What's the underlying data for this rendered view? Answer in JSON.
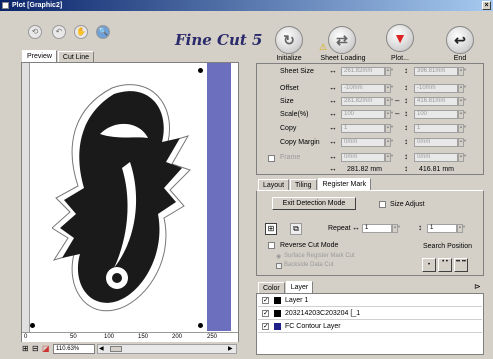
{
  "window": {
    "title": "Plot [Graphic2]",
    "close": "×"
  },
  "toolbar": {
    "logo": "Fine Cut 5",
    "buttons": [
      {
        "label": "Initialize",
        "icon": "↻"
      },
      {
        "label": "Sheet Loading",
        "icon": "⇄"
      },
      {
        "label": "Plot...",
        "icon": "▼"
      },
      {
        "label": "End",
        "icon": "↩"
      }
    ],
    "small_icons": [
      "⟲",
      "↶",
      "✋",
      "🔍"
    ]
  },
  "left_tabs": [
    "Preview",
    "Cut Line"
  ],
  "settings": {
    "sheet_size": {
      "label": "Sheet Size",
      "w": "261.82mm",
      "h": "396.81mm"
    },
    "offset": {
      "label": "Offset",
      "w": "-10mm",
      "h": "-10mm"
    },
    "size": {
      "label": "Size",
      "w": "281.82mm",
      "h": "416.81mm"
    },
    "scale": {
      "label": "Scale(%)",
      "w": "100",
      "h": "100"
    },
    "copy": {
      "label": "Copy",
      "w": "1",
      "h": "1"
    },
    "copy_margin": {
      "label": "Copy Margin",
      "w": "0mm",
      "h": "0mm"
    },
    "frame": {
      "label": "Frame",
      "w": "0mm",
      "h": "0mm"
    },
    "total_w": "281.82 mm",
    "total_h": "416.81 mm"
  },
  "mid_tabs": [
    "Layout",
    "Tiling",
    "Register Mark"
  ],
  "register": {
    "exit_button": "Exit Detection Mode",
    "size_adjust": "Size Adjust",
    "repeat_label": "Repeat",
    "repeat_w": "1",
    "repeat_h": "1",
    "reverse_cut": "Reverse Cut Mode",
    "surface": "Surface Register Mark Cut",
    "backside": "Backside Data Cut",
    "search_position": "Search Position"
  },
  "layer_tabs": [
    "Color",
    "Layer"
  ],
  "layers": [
    {
      "name": "Layer 1",
      "color": "#000000"
    },
    {
      "name": "203214203C203204 [_1",
      "color": "#000000"
    },
    {
      "name": "FC Contour Layer",
      "color": "#1f1f8a"
    }
  ],
  "ruler": {
    "ticks": [
      "0",
      "50",
      "100",
      "150",
      "200",
      "250"
    ]
  },
  "zoom": "110.63%",
  "colors": {
    "sheet_band": "#6b6fbd",
    "fish": "#1a1a1a"
  }
}
